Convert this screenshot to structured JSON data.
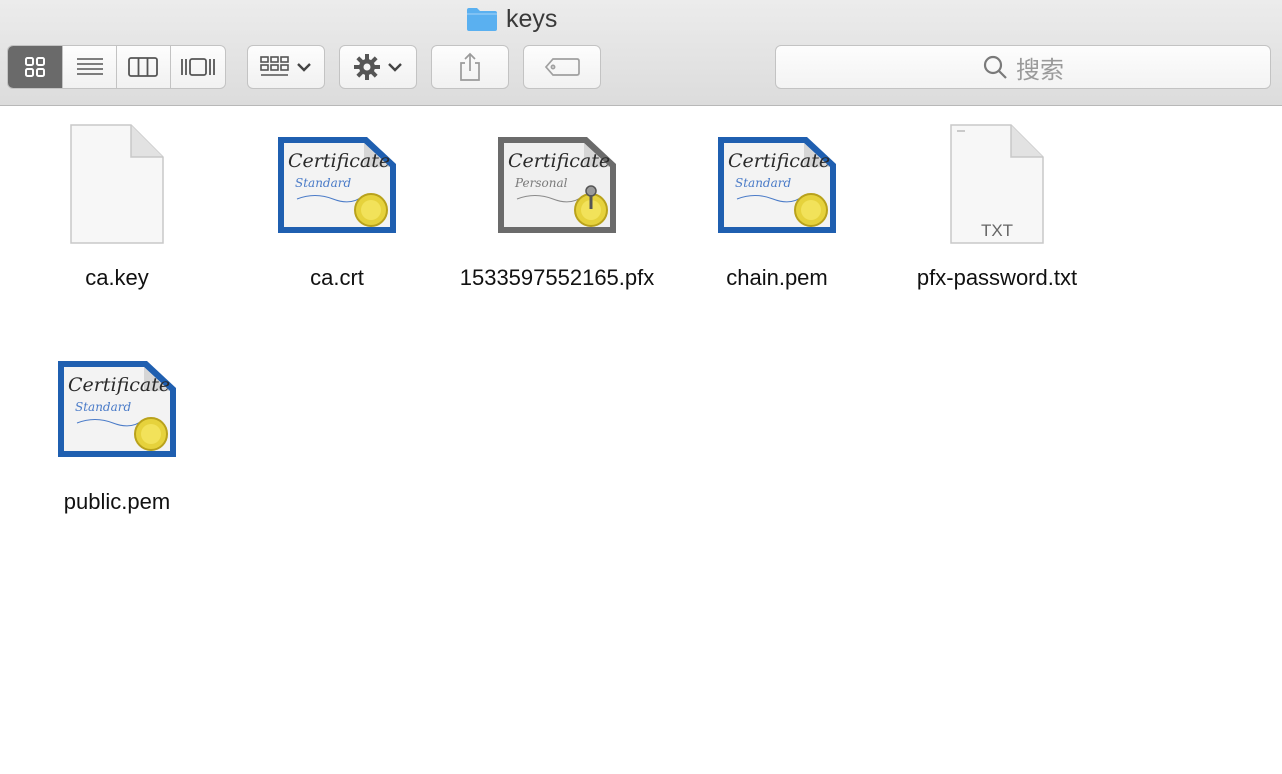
{
  "window": {
    "title": "keys"
  },
  "toolbar": {
    "view_buttons": [
      "icon-view",
      "list-view",
      "column-view",
      "cover-flow-view"
    ],
    "search_placeholder": "搜索"
  },
  "files": [
    {
      "name": "ca.key",
      "icon": "blank-document-icon"
    },
    {
      "name": "ca.crt",
      "icon": "certificate-standard-icon"
    },
    {
      "name": "1533597552165.pfx",
      "icon": "certificate-personal-icon"
    },
    {
      "name": "chain.pem",
      "icon": "certificate-standard-icon"
    },
    {
      "name": "pfx-password.txt",
      "icon": "txt-document-icon",
      "badge": "TXT"
    },
    {
      "name": "public.pem",
      "icon": "certificate-standard-icon"
    }
  ],
  "cert_text": {
    "title": "Certificate",
    "standard": "Standard",
    "personal": "Personal"
  },
  "colors": {
    "folder": "#5ab0f0",
    "cert_blue": "#1f5fb0",
    "cert_gray": "#6b6b6b",
    "seal": "#e6d23c"
  }
}
